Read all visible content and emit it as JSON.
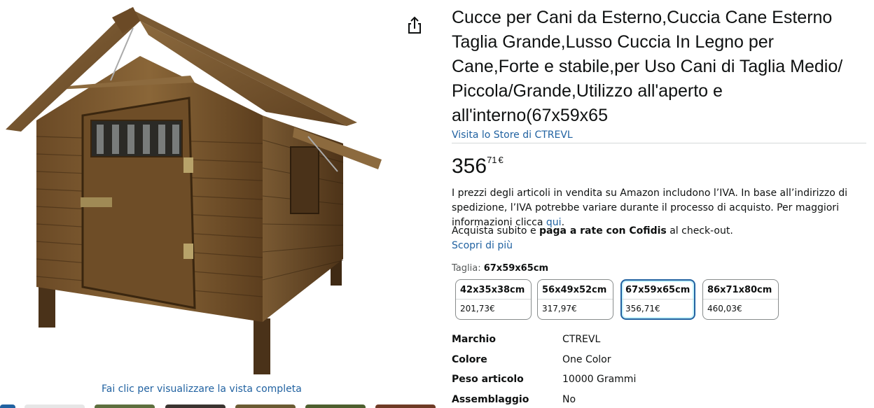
{
  "product": {
    "title": "Cucce per Cani da Esterno,Cuccia Cane Esterno Taglia Grande,Lusso Cuccia In Legno per Cane,Forte e stabile,per Uso Cani di Taglia Medio/ Piccola/Grande,Utilizzo all'aperto e all'interno(67x59x65",
    "store_link": "Visita lo Store di CTREVL"
  },
  "gallery": {
    "full_view_text": "Fai clic per visualizzare la vista completa",
    "share_icon": "share-icon"
  },
  "price": {
    "whole": "356",
    "fraction": "71",
    "symbol": "€"
  },
  "vat": {
    "text": "I prezzi degli articoli in vendita su Amazon includono l’IVA. In base all’indirizzo di spedizione, l’IVA potrebbe variare durante il processo di acquisto. Per maggiori informazioni clicca ",
    "link": "qui",
    "end": "."
  },
  "financing": {
    "prefix": "Acquista subito e ",
    "bold": "paga a rate con Cofidis",
    "suffix": " al check-out.",
    "learn_more": "Scopri di più"
  },
  "size": {
    "label": "Taglia: ",
    "selected": "67x59x65cm",
    "options": [
      {
        "dim": "42x35x38cm",
        "price": "201,73€"
      },
      {
        "dim": "56x49x52cm",
        "price": "317,97€"
      },
      {
        "dim": "67x59x65cm",
        "price": "356,71€"
      },
      {
        "dim": "86x71x80cm",
        "price": "460,03€"
      }
    ]
  },
  "specs": [
    {
      "key": "Marchio",
      "value": "CTREVL"
    },
    {
      "key": "Colore",
      "value": "One Color"
    },
    {
      "key": "Peso articolo",
      "value": "10000 Grammi"
    },
    {
      "key": "Assemblaggio",
      "value": "No"
    }
  ],
  "colors": {
    "link": "#2162a1",
    "selected_border": "#2162a1",
    "text": "#0f1111"
  }
}
